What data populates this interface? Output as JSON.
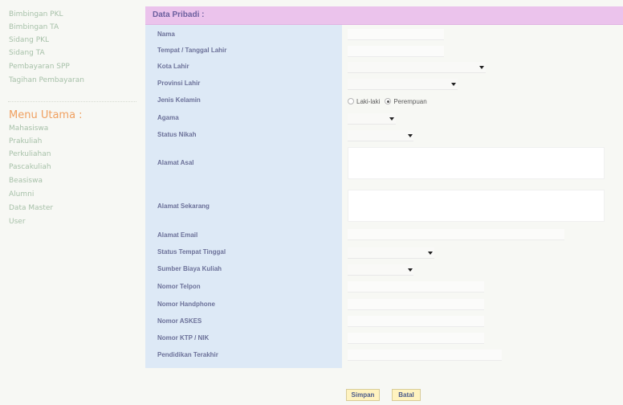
{
  "sidebar": {
    "links_top": [
      "Bimbingan PKL",
      "Bimbingan TA",
      "Sidang PKL",
      "Sidang TA",
      "Pembayaran SPP",
      "Tagihan Pembayaran"
    ],
    "menu_title": "Menu Utama :",
    "links_main": [
      "Mahasiswa",
      "Prakuliah",
      "Perkuliahan",
      "Pascakuliah",
      "Beasiswa",
      "Alumni",
      "Data Master",
      "User"
    ]
  },
  "form": {
    "title": "Data Pribadi :",
    "labels": {
      "nama": "Nama",
      "ttl": "Tempat / Tanggal Lahir",
      "kota_lahir": "Kota Lahir",
      "provinsi_lahir": "Provinsi Lahir",
      "jenis_kelamin": "Jenis Kelamin",
      "agama": "Agama",
      "status_nikah": "Status Nikah",
      "alamat_asal": "Alamat Asal",
      "alamat_sekarang": "Alamat Sekarang",
      "alamat_email": "Alamat Email",
      "status_tempat_tinggal": "Status Tempat Tinggal",
      "sumber_biaya": "Sumber Biaya Kuliah",
      "telpon": "Nomor Telpon",
      "handphone": "Nomor Handphone",
      "askes": "Nomor ASKES",
      "ktp": "Nomor KTP / NIK",
      "pendidikan": "Pendidikan Terakhir"
    },
    "gender_options": [
      "Laki-laki",
      "Perempuan"
    ],
    "gender_selected": "Perempuan"
  },
  "buttons": {
    "save": "Simpan",
    "cancel": "Batal"
  }
}
